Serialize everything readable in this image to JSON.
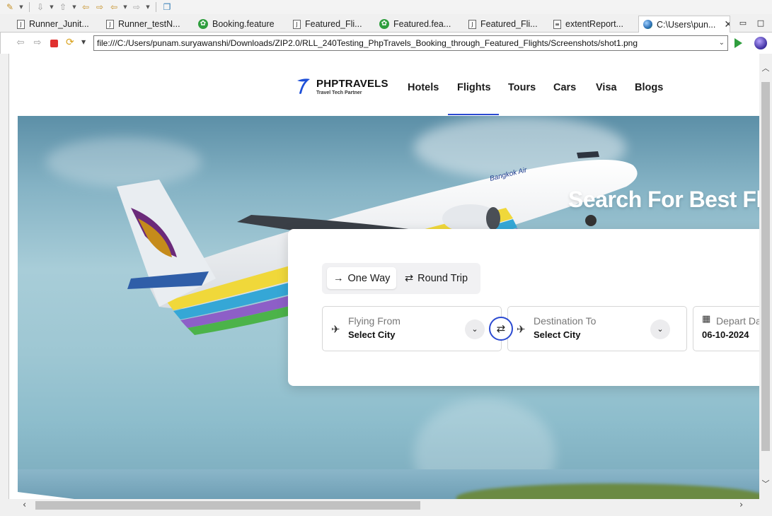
{
  "tabs": [
    {
      "label": "Runner_Junit...",
      "icon": "file-icon"
    },
    {
      "label": "Runner_testN...",
      "icon": "file-icon"
    },
    {
      "label": "Booking.feature",
      "icon": "cucumber-icon"
    },
    {
      "label": "Featured_Fli...",
      "icon": "file-icon"
    },
    {
      "label": "Featured.fea...",
      "icon": "cucumber-icon"
    },
    {
      "label": "Featured_Fli...",
      "icon": "file-icon"
    },
    {
      "label": "extentReport...",
      "icon": "file-icon"
    },
    {
      "label": "C:\\Users\\pun...",
      "icon": "globe-icon"
    }
  ],
  "address": {
    "url": "file:///C:/Users/punam.suryawanshi/Downloads/ZIP2.0/RLL_240Testing_PhpTravels_Booking_through_Featured_Flights/Screenshots/shot1.png"
  },
  "site": {
    "brand": "PHPTRAVELS",
    "tagline": "Travel Tech Partner",
    "nav": [
      {
        "label": "Hotels"
      },
      {
        "label": "Flights"
      },
      {
        "label": "Tours"
      },
      {
        "label": "Cars"
      },
      {
        "label": "Visa"
      },
      {
        "label": "Blogs"
      }
    ],
    "active_nav": "Flights",
    "accent_color": "#2b4ad1"
  },
  "hero": {
    "title": "Search For Best Fli"
  },
  "search": {
    "trip_types": [
      {
        "label": "One Way",
        "selected": true
      },
      {
        "label": "Round Trip",
        "selected": false
      }
    ],
    "from": {
      "label": "Flying From",
      "value": "Select City"
    },
    "to": {
      "label": "Destination To",
      "value": "Select City"
    },
    "depart": {
      "label": "Depart Da",
      "value": "06-10-2024"
    }
  }
}
